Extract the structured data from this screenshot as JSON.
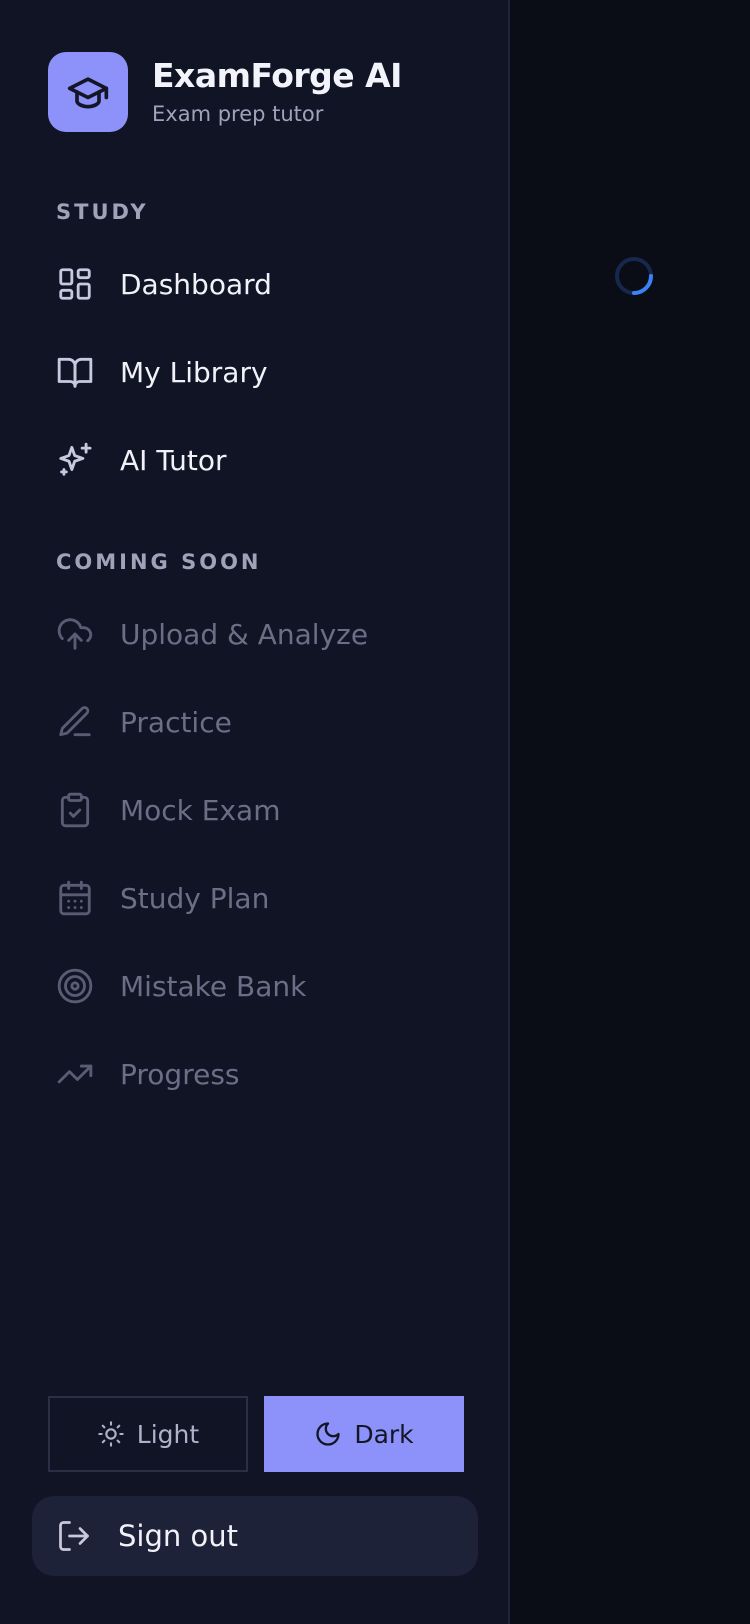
{
  "brand": {
    "title": "ExamForge AI",
    "subtitle": "Exam prep tutor",
    "logo_icon": "graduation-cap-icon",
    "accent": "#8d92fb"
  },
  "sections": {
    "study_label": "STUDY",
    "coming_soon_label": "COMING SOON"
  },
  "study_items": [
    {
      "label": "Dashboard",
      "icon": "dashboard-grid-icon"
    },
    {
      "label": "My Library",
      "icon": "open-book-icon"
    },
    {
      "label": "AI Tutor",
      "icon": "sparkles-icon"
    }
  ],
  "coming_soon_items": [
    {
      "label": "Upload & Analyze",
      "icon": "cloud-upload-icon"
    },
    {
      "label": "Practice",
      "icon": "pencil-icon"
    },
    {
      "label": "Mock Exam",
      "icon": "clipboard-check-icon"
    },
    {
      "label": "Study Plan",
      "icon": "calendar-icon"
    },
    {
      "label": "Mistake Bank",
      "icon": "target-icon"
    },
    {
      "label": "Progress",
      "icon": "trending-up-icon"
    }
  ],
  "theme": {
    "light_label": "Light",
    "dark_label": "Dark",
    "selected": "Dark"
  },
  "signout": {
    "label": "Sign out",
    "icon": "log-out-icon"
  },
  "main": {
    "loading_icon": "loading-spinner-icon"
  },
  "colors": {
    "sidebar_bg": "#111425",
    "main_bg": "#0a0c16",
    "spinner": "#3b82f6"
  }
}
